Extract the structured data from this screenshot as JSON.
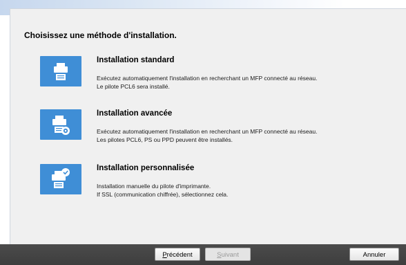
{
  "heading": "Choisissez une méthode d'installation.",
  "options": [
    {
      "title": "Installation standard",
      "desc": [
        "Exécutez automatiquement l'installation en recherchant un MFP connecté au réseau.",
        "Le pilote PCL6 sera installé."
      ],
      "icon": "printer-icon"
    },
    {
      "title": "Installation avancée",
      "desc": [
        "Exécutez automatiquement l'installation en recherchant un MFP connecté au réseau.",
        "Les pilotes PCL6, PS ou PPD peuvent être installés."
      ],
      "icon": "printer-gear-icon"
    },
    {
      "title": "Installation personnalisée",
      "desc": [
        "Installation manuelle du pilote d'imprimante.",
        "If SSL (communication chiffrée), sélectionnez cela."
      ],
      "icon": "printer-check-icon"
    }
  ],
  "buttons": {
    "prev": {
      "accel": "P",
      "rest": "récédent"
    },
    "next": {
      "accel": "S",
      "rest": "uivant",
      "disabled": true
    },
    "cancel": "Annuler"
  },
  "colors": {
    "tile": "#3f8ed6",
    "footer": "#444444",
    "panel": "#f0f0f0"
  }
}
